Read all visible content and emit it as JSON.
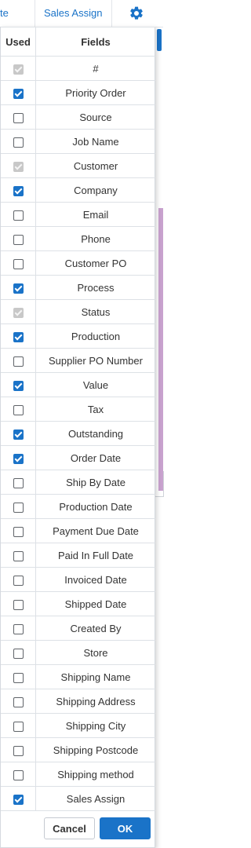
{
  "background": {
    "header_partial": "te",
    "header_sales_assign": "Sales Assign",
    "accent_color": "#1a73c8",
    "highlight_color": "#c9a3cf"
  },
  "panel": {
    "header_used": "Used",
    "header_fields": "Fields",
    "rows": [
      {
        "label": "#",
        "state": "disabled"
      },
      {
        "label": "Priority Order",
        "state": "checked"
      },
      {
        "label": "Source",
        "state": "unchecked"
      },
      {
        "label": "Job Name",
        "state": "unchecked"
      },
      {
        "label": "Customer",
        "state": "disabled"
      },
      {
        "label": "Company",
        "state": "checked"
      },
      {
        "label": "Email",
        "state": "unchecked"
      },
      {
        "label": "Phone",
        "state": "unchecked"
      },
      {
        "label": "Customer PO",
        "state": "unchecked"
      },
      {
        "label": "Process",
        "state": "checked"
      },
      {
        "label": "Status",
        "state": "disabled"
      },
      {
        "label": "Production",
        "state": "checked"
      },
      {
        "label": "Supplier PO Number",
        "state": "unchecked"
      },
      {
        "label": "Value",
        "state": "checked"
      },
      {
        "label": "Tax",
        "state": "unchecked"
      },
      {
        "label": "Outstanding",
        "state": "checked"
      },
      {
        "label": "Order Date",
        "state": "checked"
      },
      {
        "label": "Ship By Date",
        "state": "unchecked"
      },
      {
        "label": "Production Date",
        "state": "unchecked"
      },
      {
        "label": "Payment Due Date",
        "state": "unchecked"
      },
      {
        "label": "Paid In Full Date",
        "state": "unchecked"
      },
      {
        "label": "Invoiced Date",
        "state": "unchecked"
      },
      {
        "label": "Shipped Date",
        "state": "unchecked"
      },
      {
        "label": "Created By",
        "state": "unchecked"
      },
      {
        "label": "Store",
        "state": "unchecked"
      },
      {
        "label": "Shipping Name",
        "state": "unchecked"
      },
      {
        "label": "Shipping Address",
        "state": "unchecked"
      },
      {
        "label": "Shipping City",
        "state": "unchecked"
      },
      {
        "label": "Shipping Postcode",
        "state": "unchecked"
      },
      {
        "label": "Shipping method",
        "state": "unchecked"
      },
      {
        "label": "Sales Assign",
        "state": "checked"
      }
    ],
    "cancel_label": "Cancel",
    "ok_label": "OK"
  }
}
